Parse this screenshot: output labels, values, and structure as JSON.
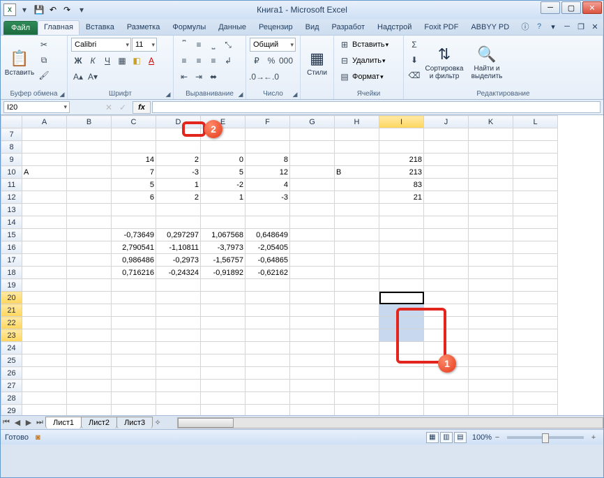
{
  "title": "Книга1 - Microsoft Excel",
  "qat": {
    "save_tip": "save",
    "undo_tip": "undo",
    "redo_tip": "redo"
  },
  "tabs": {
    "file": "Файл",
    "items": [
      "Главная",
      "Вставка",
      "Разметка",
      "Формулы",
      "Данные",
      "Рецензир",
      "Вид",
      "Разработ",
      "Надстрой",
      "Foxit PDF",
      "ABBYY PD"
    ],
    "active_index": 0
  },
  "ribbon": {
    "clipboard": {
      "title": "Буфер обмена",
      "paste": "Вставить"
    },
    "font": {
      "title": "Шрифт",
      "name": "Calibri",
      "size": "11"
    },
    "alignment": {
      "title": "Выравнивание"
    },
    "number": {
      "title": "Число",
      "format": "Общий"
    },
    "styles": {
      "title": "",
      "btn": "Стили"
    },
    "cells": {
      "title": "Ячейки",
      "insert": "Вставить",
      "delete": "Удалить",
      "format": "Формат"
    },
    "editing": {
      "title": "Редактирование",
      "sort": "Сортировка\nи фильтр",
      "find": "Найти и\nвыделить"
    }
  },
  "name_box": "I20",
  "fx_label": "fx",
  "columns": [
    "A",
    "B",
    "C",
    "D",
    "E",
    "F",
    "G",
    "H",
    "I",
    "J",
    "K",
    "L"
  ],
  "selected_col": "I",
  "row_start": 7,
  "row_end": 29,
  "selected_rows": [
    20,
    21,
    22,
    23
  ],
  "active_cell": {
    "row": 20,
    "col": "I"
  },
  "cells": {
    "9": {
      "C": "14",
      "D": "2",
      "E": "0",
      "F": "8",
      "I": "218"
    },
    "10": {
      "A": "А",
      "C": "7",
      "D": "-3",
      "E": "5",
      "F": "12",
      "H": "В",
      "I": "213"
    },
    "11": {
      "C": "5",
      "D": "1",
      "E": "-2",
      "F": "4",
      "I": "83"
    },
    "12": {
      "C": "6",
      "D": "2",
      "E": "1",
      "F": "-3",
      "I": "21"
    },
    "15": {
      "C": "-0,73649",
      "D": "0,297297",
      "E": "1,067568",
      "F": "0,648649"
    },
    "16": {
      "C": "2,790541",
      "D": "-1,10811",
      "E": "-3,7973",
      "F": "-2,05405"
    },
    "17": {
      "C": "0,986486",
      "D": "-0,2973",
      "E": "-1,56757",
      "F": "-0,64865"
    },
    "18": {
      "C": "0,716216",
      "D": "-0,24324",
      "E": "-0,91892",
      "F": "-0,62162"
    }
  },
  "callouts": {
    "c1": "1",
    "c2": "2"
  },
  "sheets": {
    "active": "Лист1",
    "others": [
      "Лист2",
      "Лист3"
    ]
  },
  "status": {
    "ready": "Готово",
    "zoom": "100%"
  }
}
